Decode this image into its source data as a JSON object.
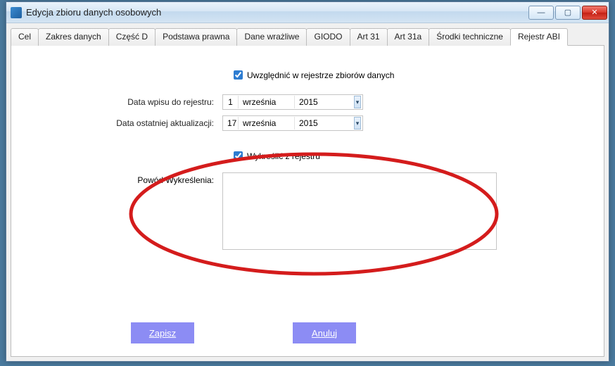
{
  "window": {
    "title": "Edycja zbioru danych osobowych"
  },
  "tabs": [
    {
      "label": "Cel"
    },
    {
      "label": "Zakres danych"
    },
    {
      "label": "Część D"
    },
    {
      "label": "Podstawa prawna"
    },
    {
      "label": "Dane wrażliwe"
    },
    {
      "label": "GIODO"
    },
    {
      "label": "Art 31"
    },
    {
      "label": "Art 31a"
    },
    {
      "label": "Środki techniczne"
    },
    {
      "label": "Rejestr ABI"
    }
  ],
  "active_tab": "Rejestr ABI",
  "form": {
    "include_in_register_label": "Uwzględnić w rejestrze zbiorów danych",
    "include_in_register_checked": true,
    "entry_date_label": "Data wpisu do rejestru:",
    "entry_date": {
      "day": "1",
      "month": "września",
      "year": "2015"
    },
    "update_date_label": "Data ostatniej aktualizacji:",
    "update_date": {
      "day": "17",
      "month": "września",
      "year": "2015"
    },
    "remove_label": "Wykreślić z rejestru",
    "remove_checked": true,
    "reason_label": "Powód Wykreślenia:",
    "reason_value": ""
  },
  "buttons": {
    "save": "Zapisz",
    "cancel": "Anuluj"
  },
  "win_controls": {
    "minimize": "—",
    "maximize": "▢",
    "close": "✕"
  }
}
